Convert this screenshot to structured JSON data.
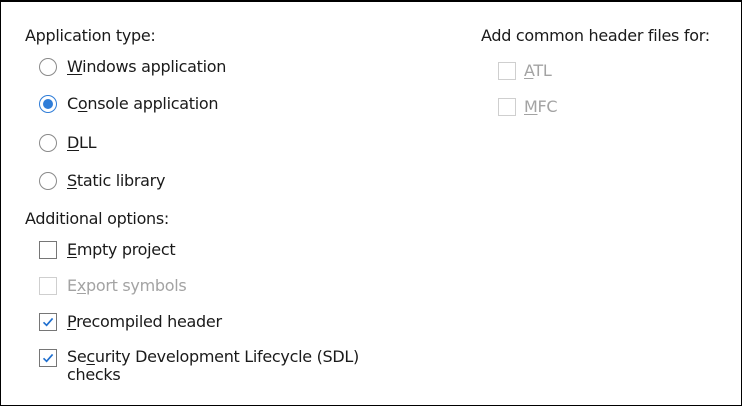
{
  "application_type": {
    "heading": "Application type:",
    "options": [
      {
        "pre": "",
        "key": "W",
        "post": "indows application",
        "selected": false
      },
      {
        "pre": "C",
        "key": "o",
        "post": "nsole application",
        "selected": true
      },
      {
        "pre": "",
        "key": "D",
        "post": "LL",
        "selected": false
      },
      {
        "pre": "",
        "key": "S",
        "post": "tatic library",
        "selected": false
      }
    ]
  },
  "additional_options": {
    "heading": "Additional options:",
    "items": [
      {
        "pre": "",
        "key": "E",
        "post": "mpty project",
        "checked": false,
        "enabled": true
      },
      {
        "pre": "E",
        "key": "x",
        "post": "port symbols",
        "checked": false,
        "enabled": false
      },
      {
        "pre": "",
        "key": "P",
        "post": "recompiled header",
        "checked": true,
        "enabled": true
      },
      {
        "pre": "Se",
        "key": "c",
        "post": "urity Development Lifecycle (SDL)",
        "line2": "checks",
        "checked": true,
        "enabled": true
      }
    ]
  },
  "header_files": {
    "heading": "Add common header files for:",
    "items": [
      {
        "pre": "",
        "key": "A",
        "post": "TL",
        "checked": false,
        "enabled": false
      },
      {
        "pre": "",
        "key": "M",
        "post": "FC",
        "checked": false,
        "enabled": false
      }
    ]
  },
  "colors": {
    "accent": "#2f7dd8",
    "disabled_text": "#a3a3a3",
    "border": "#767676"
  }
}
